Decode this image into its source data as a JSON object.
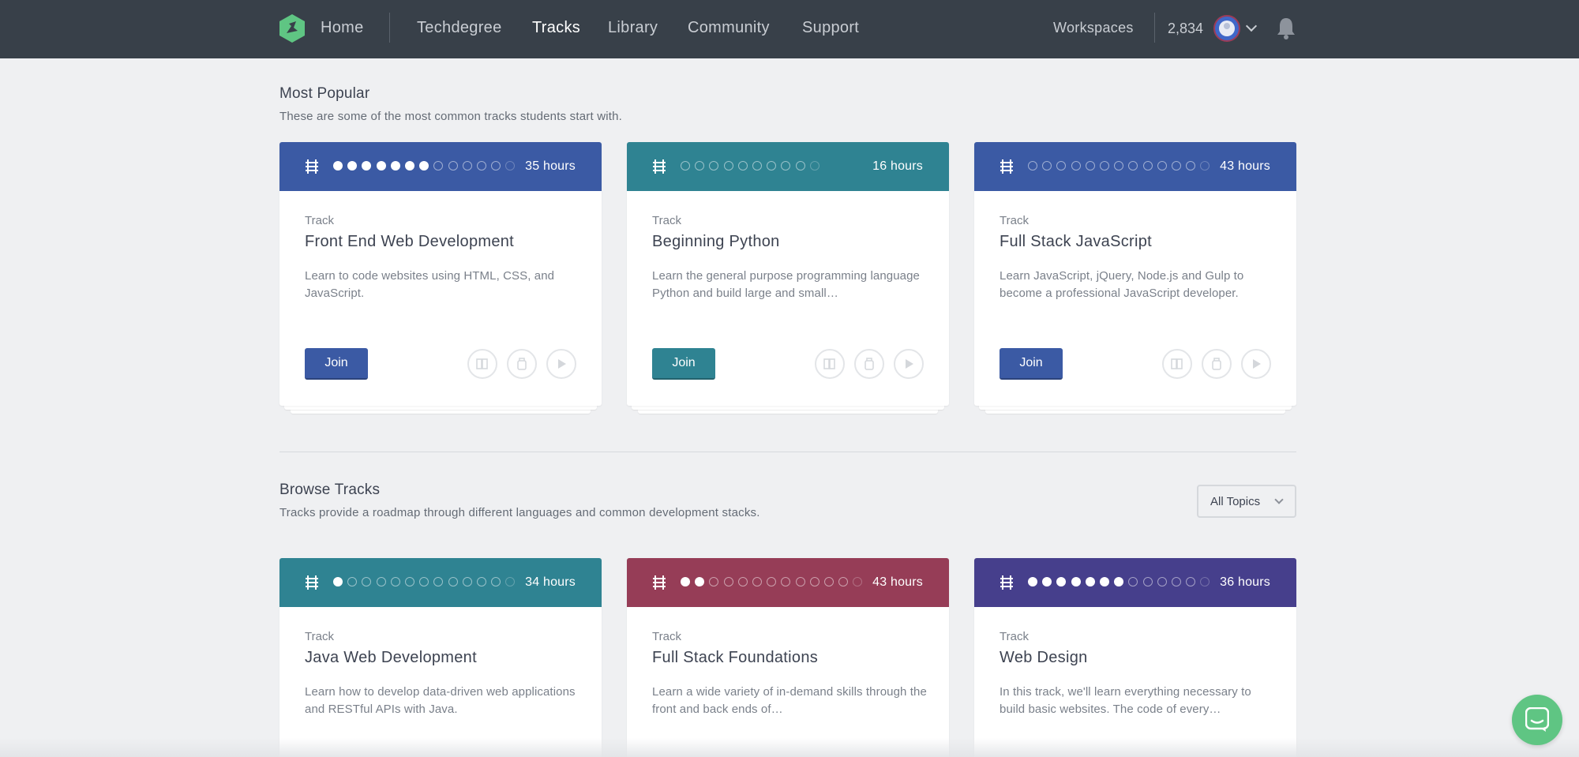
{
  "nav": {
    "logo_icon": "treehouse-logo-icon",
    "home": "Home",
    "links": [
      "Techdegree",
      "Tracks",
      "Library",
      "Community",
      "Support"
    ],
    "active": "Tracks",
    "workspaces": "Workspaces",
    "points": "2,834",
    "icons": [
      "avatar",
      "chevron-down-icon",
      "bell-icon"
    ]
  },
  "popular": {
    "title": "Most Popular",
    "subtitle": "These are some of the most common tracks students start with."
  },
  "browse": {
    "title": "Browse Tracks",
    "subtitle": "Tracks provide a roadmap through different languages and common development stacks.",
    "filter": "All Topics"
  },
  "cards": [
    {
      "color": "#3b5aa4",
      "hours": "35 hours",
      "type": "Track",
      "title": "Front End Web Development",
      "desc": "Learn to code websites using HTML, CSS, and JavaScript.",
      "join": "Join",
      "progress": {
        "filled": 7,
        "total": 13
      }
    },
    {
      "color": "#2f8392",
      "hours": "16 hours",
      "type": "Track",
      "title": "Beginning Python",
      "desc": "Learn the general purpose programming language Python and build large and small…",
      "join": "Join",
      "progress": {
        "filled": 0,
        "total": 10
      }
    },
    {
      "color": "#3b5aa4",
      "hours": "43 hours",
      "type": "Track",
      "title": "Full Stack JavaScript",
      "desc": "Learn JavaScript, jQuery, Node.js and Gulp to become a professional JavaScript developer.",
      "join": "Join",
      "progress": {
        "filled": 0,
        "total": 13
      }
    },
    {
      "color": "#2f8392",
      "hours": "34 hours",
      "type": "Track",
      "title": "Java Web Development",
      "desc": "Learn how to develop data-driven web applications and RESTful APIs with Java.",
      "progress": {
        "filled": 1,
        "total": 13
      }
    },
    {
      "color": "#963d57",
      "hours": "43 hours",
      "type": "Track",
      "title": "Full Stack Foundations",
      "desc": "Learn a wide variety of in-demand skills through the front and back ends of…",
      "progress": {
        "filled": 2,
        "total": 13
      }
    },
    {
      "color": "#463f8c",
      "hours": "36 hours",
      "type": "Track",
      "title": "Web Design",
      "desc": "In this track, we'll learn everything necessary to build basic websites. The code of every…",
      "progress": {
        "filled": 7,
        "total": 13
      }
    }
  ],
  "resource_icons": [
    "library-icon",
    "badge-icon",
    "play-icon"
  ],
  "chat_icon": "chat-icon"
}
